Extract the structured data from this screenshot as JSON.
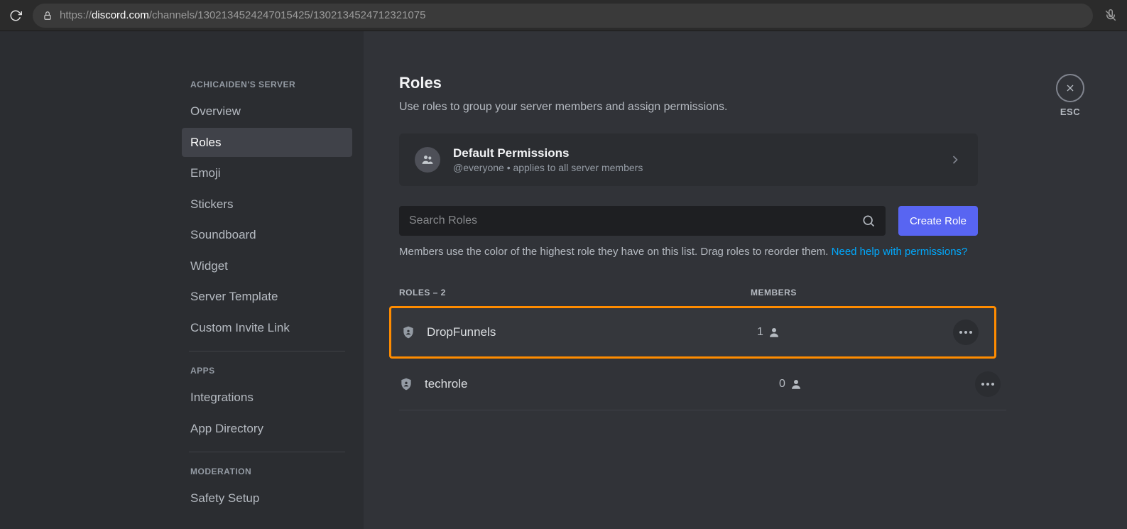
{
  "browser": {
    "url_domain": "discord.com",
    "url_prefix": "https://",
    "url_path": "/channels/1302134524247015425/1302134524712321075"
  },
  "sidebar": {
    "server_header": "ACHICAIDEN'S SERVER",
    "items_main": [
      {
        "label": "Overview"
      },
      {
        "label": "Roles"
      },
      {
        "label": "Emoji"
      },
      {
        "label": "Stickers"
      },
      {
        "label": "Soundboard"
      },
      {
        "label": "Widget"
      },
      {
        "label": "Server Template"
      },
      {
        "label": "Custom Invite Link"
      }
    ],
    "apps_header": "APPS",
    "items_apps": [
      {
        "label": "Integrations"
      },
      {
        "label": "App Directory"
      }
    ],
    "moderation_header": "MODERATION",
    "items_mod": [
      {
        "label": "Safety Setup"
      }
    ]
  },
  "content": {
    "title": "Roles",
    "subtitle": "Use roles to group your server members and assign permissions.",
    "esc_label": "ESC",
    "default_card": {
      "title": "Default Permissions",
      "subtitle": "@everyone • applies to all server members"
    },
    "search_placeholder": "Search Roles",
    "create_button": "Create Role",
    "hint_prefix": "Members use the color of the highest role they have on this list. Drag roles to reorder them. ",
    "hint_link": "Need help with permissions?",
    "table": {
      "roles_header": "ROLES – 2",
      "members_header": "MEMBERS",
      "rows": [
        {
          "name": "DropFunnels",
          "members": "1",
          "highlight": true
        },
        {
          "name": "techrole",
          "members": "0",
          "highlight": false
        }
      ]
    }
  }
}
